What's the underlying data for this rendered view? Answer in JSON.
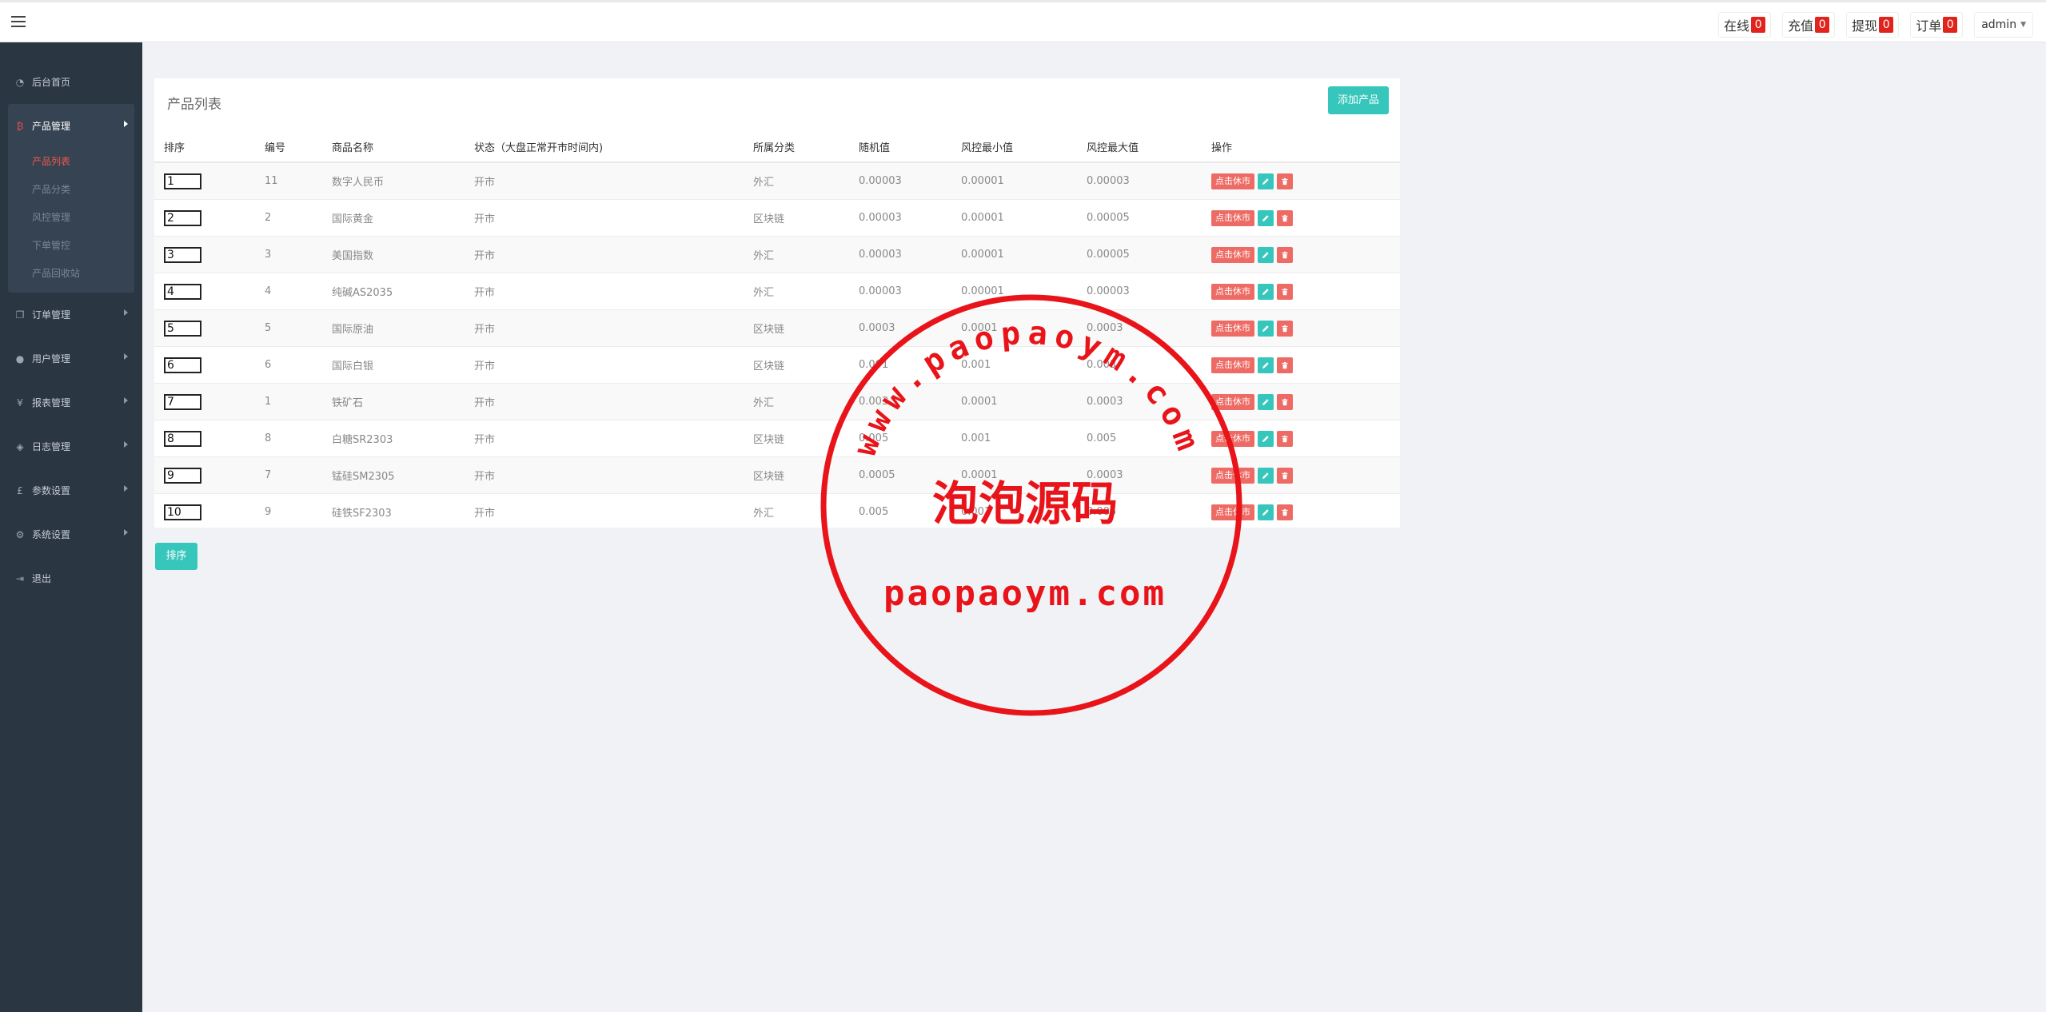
{
  "header": {
    "stats": [
      {
        "label": "在线",
        "count": "0"
      },
      {
        "label": "充值",
        "count": "0"
      },
      {
        "label": "提现",
        "count": "0"
      },
      {
        "label": "订单",
        "count": "0"
      }
    ],
    "user": "admin"
  },
  "sidebar": {
    "home": "后台首页",
    "product_group": {
      "label": "产品管理",
      "items": [
        "产品列表",
        "产品分类",
        "风控管理",
        "下单管控",
        "产品回收站"
      ]
    },
    "items": [
      "订单管理",
      "用户管理",
      "报表管理",
      "日志管理",
      "参数设置",
      "系统设置"
    ],
    "logout": "退出"
  },
  "panel": {
    "title": "产品列表",
    "add_button": "添加产品",
    "columns": [
      "排序",
      "编号",
      "商品名称",
      "状态（大盘正常开市时间内)",
      "所属分类",
      "随机值",
      "风控最小值",
      "风控最大值",
      "操作"
    ],
    "rows": [
      {
        "sort": "1",
        "id": "11",
        "name": "数字人民币",
        "status": "开市",
        "category": "外汇",
        "random": "0.00003",
        "min": "0.00001",
        "max": "0.00003"
      },
      {
        "sort": "2",
        "id": "2",
        "name": "国际黄金",
        "status": "开市",
        "category": "区块链",
        "random": "0.00003",
        "min": "0.00001",
        "max": "0.00005"
      },
      {
        "sort": "3",
        "id": "3",
        "name": "美国指数",
        "status": "开市",
        "category": "外汇",
        "random": "0.00003",
        "min": "0.00001",
        "max": "0.00005"
      },
      {
        "sort": "4",
        "id": "4",
        "name": "纯碱AS2035",
        "status": "开市",
        "category": "外汇",
        "random": "0.00003",
        "min": "0.00001",
        "max": "0.00003"
      },
      {
        "sort": "5",
        "id": "5",
        "name": "国际原油",
        "status": "开市",
        "category": "区块链",
        "random": "0.0003",
        "min": "0.0001",
        "max": "0.0003"
      },
      {
        "sort": "6",
        "id": "6",
        "name": "国际白银",
        "status": "开市",
        "category": "区块链",
        "random": "0.001",
        "min": "0.001",
        "max": "0.003"
      },
      {
        "sort": "7",
        "id": "1",
        "name": "铁矿石",
        "status": "开市",
        "category": "外汇",
        "random": "0.003",
        "min": "0.0001",
        "max": "0.0003"
      },
      {
        "sort": "8",
        "id": "8",
        "name": "白糖SR2303",
        "status": "开市",
        "category": "区块链",
        "random": "0.005",
        "min": "0.001",
        "max": "0.005"
      },
      {
        "sort": "9",
        "id": "7",
        "name": "锰硅SM2305",
        "status": "开市",
        "category": "区块链",
        "random": "0.0005",
        "min": "0.0001",
        "max": "0.0003"
      },
      {
        "sort": "10",
        "id": "9",
        "name": "硅铁SF2303",
        "status": "开市",
        "category": "外汇",
        "random": "0.005",
        "min": "0.001",
        "max": "0.005"
      }
    ],
    "close_label": "点击休市",
    "sort_button": "排序"
  },
  "watermark": {
    "ring_text": "www.paopaoym.com",
    "title": "泡泡源码",
    "url": "paopaoym.com",
    "color": "#e8141a"
  }
}
